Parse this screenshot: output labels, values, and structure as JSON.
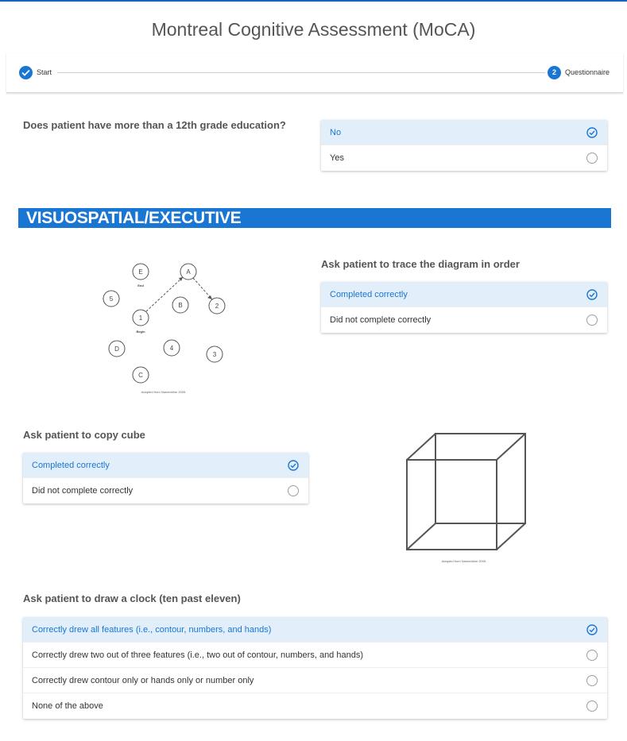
{
  "app": {
    "title": "Montreal Cognitive Assessment (MoCA)"
  },
  "stepper": {
    "steps": [
      {
        "label": "Start",
        "state": "done"
      },
      {
        "number": "2",
        "label": "Questionnaire",
        "state": "active"
      }
    ]
  },
  "colors": {
    "accent": "#1976d2",
    "selected_bg": "#e3eefb"
  },
  "q_education": {
    "question": "Does patient have more than a 12th grade education?",
    "options": [
      {
        "label": "No",
        "selected": true
      },
      {
        "label": "Yes",
        "selected": false
      }
    ]
  },
  "section": {
    "title": "VISUOSPATIAL/EXECUTIVE"
  },
  "trail_diagram": {
    "nodes": [
      "E",
      "A",
      "5",
      "B",
      "2",
      "1",
      "D",
      "4",
      "3",
      "C"
    ],
    "end_label": "End",
    "begin_label": "Begin",
    "caption": "Adapted from Nasreddine 2005."
  },
  "q_trace": {
    "question": "Ask patient to trace the diagram in order",
    "options": [
      {
        "label": "Completed correctly",
        "selected": true
      },
      {
        "label": "Did not complete correctly",
        "selected": false
      }
    ]
  },
  "q_cube": {
    "question": "Ask patient to copy cube",
    "options": [
      {
        "label": "Completed correctly",
        "selected": true
      },
      {
        "label": "Did not complete correctly",
        "selected": false
      }
    ],
    "caption": "Adapted from Nasreddine 2005."
  },
  "q_clock": {
    "question": "Ask patient to draw a clock (ten past eleven)",
    "options": [
      {
        "label": "Correctly drew all features (i.e., contour, numbers, and hands)",
        "selected": true
      },
      {
        "label": "Correctly drew two out of three features (i.e., two out of contour, numbers, and hands)",
        "selected": false
      },
      {
        "label": "Correctly drew contour only or hands only or number only",
        "selected": false
      },
      {
        "label": "None of the above",
        "selected": false
      }
    ]
  }
}
